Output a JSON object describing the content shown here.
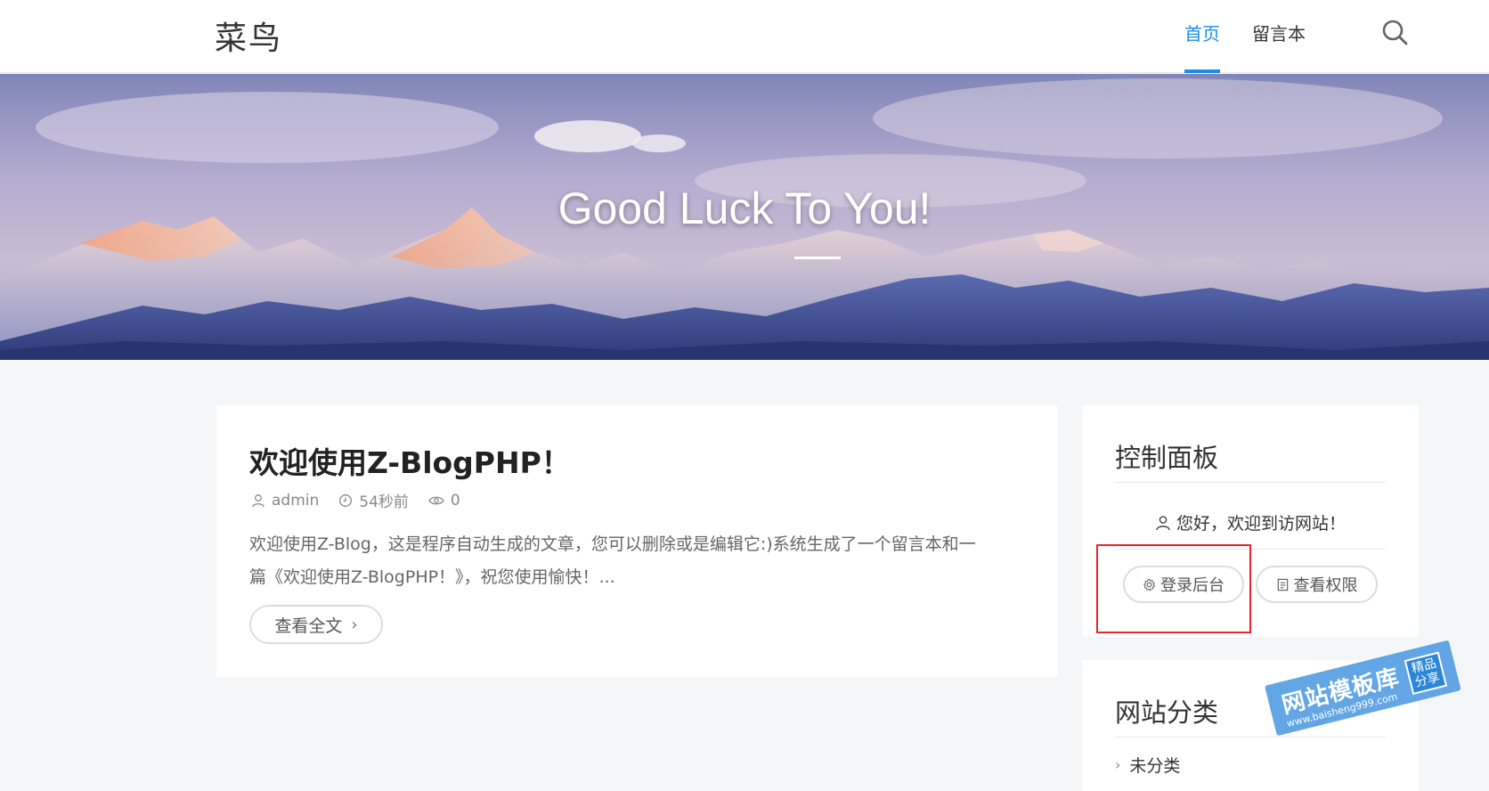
{
  "header": {
    "logo": "菜鸟",
    "nav": [
      {
        "label": "首页",
        "active": true
      },
      {
        "label": "留言本",
        "active": false
      }
    ],
    "search_icon": "search-icon"
  },
  "banner": {
    "title": "Good Luck To You!"
  },
  "post": {
    "title": "欢迎使用Z-BlogPHP！",
    "author": "admin",
    "time": "54秒前",
    "views": "0",
    "excerpt_line1": "欢迎使用Z-Blog，这是程序自动生成的文章，您可以删除或是编辑它:)系统生成了一个留言本和一",
    "excerpt_line2": "篇《欢迎使用Z-BlogPHP！》，祝您使用愉快！...",
    "readmore_label": "查看全文"
  },
  "sidebar": {
    "control_panel": {
      "title": "控制面板",
      "welcome": "您好，欢迎到访网站！",
      "login_label": "登录后台",
      "perm_label": "查看权限"
    },
    "categories": {
      "title": "网站分类",
      "items": [
        "未分类"
      ]
    }
  },
  "watermark": {
    "main": "网站模板库",
    "url": "www.baisheng999.com",
    "badge_line1": "精品",
    "badge_line2": "分享"
  },
  "colors": {
    "accent": "#1b8ee8",
    "highlight": "#e8242c"
  }
}
